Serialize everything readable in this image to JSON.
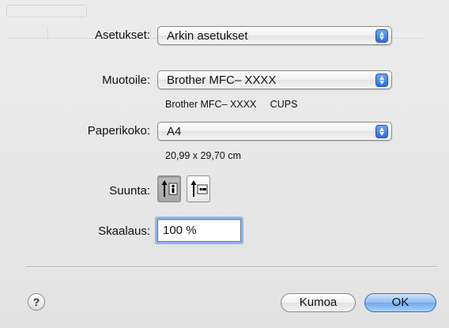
{
  "background_title": "Asetukset",
  "settings": {
    "label": "Asetukset:",
    "value": "Arkin asetukset"
  },
  "printer": {
    "label": "Muotoile:",
    "value": "Brother MFC– XXXX",
    "info": "Brother MFC– XXXX     CUPS"
  },
  "paper": {
    "label": "Paperikoko:",
    "value": "A4",
    "dimensions": "20,99 x 29,70 cm"
  },
  "orientation": {
    "label": "Suunta:",
    "selected": "portrait"
  },
  "scale": {
    "label": "Skaalaus:",
    "value": "100 %"
  },
  "buttons": {
    "help": "?",
    "cancel": "Kumoa",
    "ok": "OK"
  },
  "colors": {
    "accent": "#2d6fd6",
    "focus_ring": "#8bb6ef",
    "ok_button": "#6fa9ee"
  }
}
